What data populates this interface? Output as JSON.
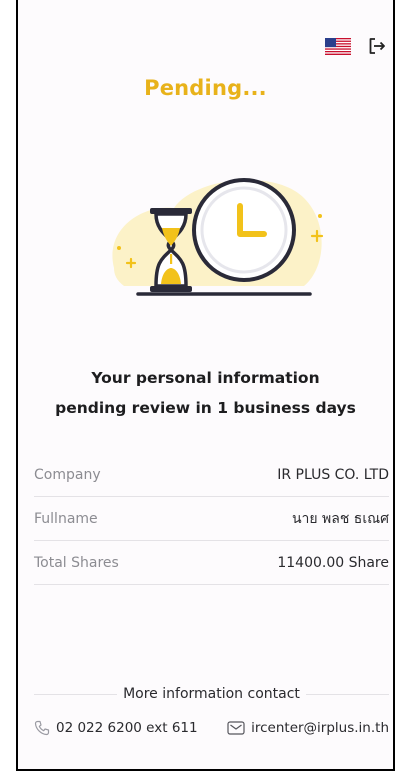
{
  "header": {
    "language_icon": "us-flag-icon",
    "logout_icon": "logout-icon"
  },
  "status": {
    "title": "Pending...",
    "message_line1": "Your personal information",
    "message_line2": "pending review in 1 business days"
  },
  "details": [
    {
      "label": "Company",
      "value": "IR PLUS CO. LTD"
    },
    {
      "label": "Fullname",
      "value": "นาย พลช ธเณศ"
    },
    {
      "label": "Total Shares",
      "value": "11400.00 Share"
    }
  ],
  "contact": {
    "heading": "More information contact",
    "phone": "02 022 6200 ext 611",
    "email": "ircenter@irplus.in.th"
  },
  "colors": {
    "accent": "#e8b21a",
    "text": "#1d1d1f",
    "muted": "#8c8c92"
  }
}
